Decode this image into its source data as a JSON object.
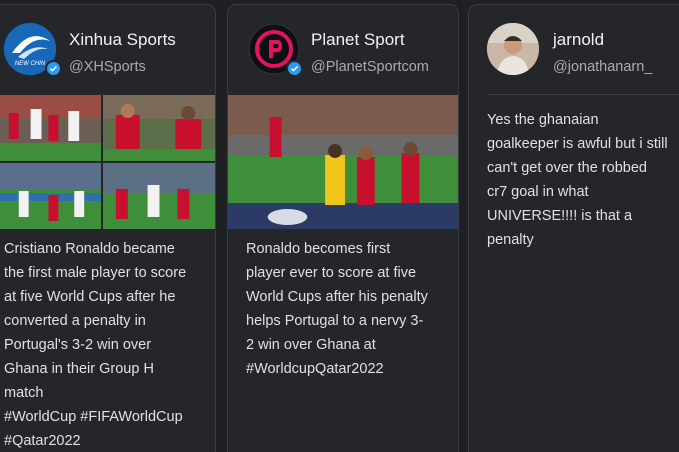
{
  "cards": [
    {
      "display_name": "Xinhua Sports",
      "handle": "@XHSports",
      "avatar_icon": "xinhua-logo-icon",
      "avatar_logo_text": "NEW CHIN",
      "verified": true,
      "has_media": true,
      "text": "Cristiano Ronaldo became\nthe first male player to score\nat five World Cups after he\nconverted a penalty in\nPortugal's 3-2 win over\nGhana in their Group H\nmatch\n#WorldCup #FIFAWorldCup\n#Qatar2022"
    },
    {
      "display_name": "Planet Sport",
      "handle": "@PlanetSportcom",
      "avatar_icon": "planet-sport-logo-icon",
      "verified": true,
      "has_media": true,
      "text": "Ronaldo becomes first\nplayer ever to score at five\nWorld Cups after his penalty\nhelps Portugal to a nervy 3-\n2 win over Ghana at\n#WorldcupQatar2022"
    },
    {
      "display_name": "jarnold",
      "handle": "@jonathanarn_",
      "avatar_icon": "user-photo-avatar",
      "verified": false,
      "has_media": false,
      "text": "Yes the ghanaian\ngoalkeeper is awful but i still\ncan't get over the robbed\ncr7 goal in what\nUNIVERSE!!!! is that a\npenalty"
    }
  ],
  "colors": {
    "background": "#1f2023",
    "card": "#25262a",
    "border": "#3a3b40",
    "verified": "#2d9bf0",
    "planet_sport_pink": "#e4135f",
    "portugal_red": "#c8102e",
    "pitch_green": "#3f8f3a"
  }
}
